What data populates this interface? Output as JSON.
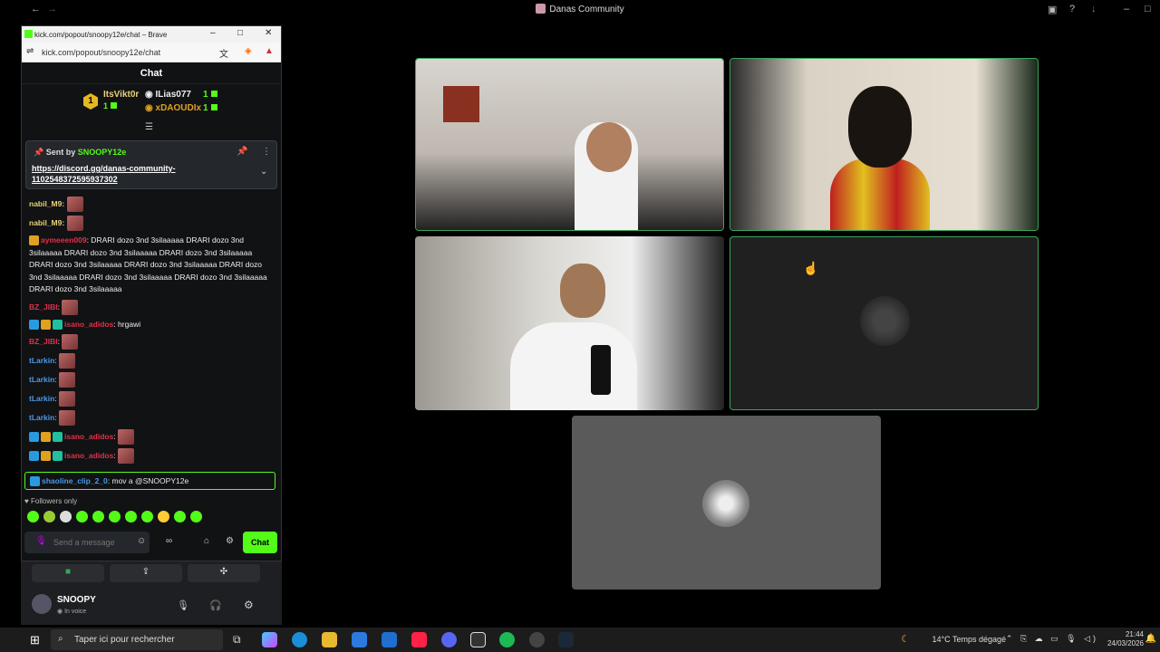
{
  "window": {
    "title": "Danas Community"
  },
  "chat_popout": {
    "tab_title": "kick.com/popout/snoopy12e/chat – Brave",
    "url": "kick.com/popout/snoopy12e/chat",
    "header": "Chat",
    "leaders": [
      {
        "rank": "1",
        "name": "ItsVikt0r",
        "count": "1"
      },
      {
        "name": "ILias077",
        "count": "1"
      },
      {
        "name": "xDAOUDIx",
        "count": "1"
      }
    ],
    "pinned": {
      "sent_by_label": "Sent by",
      "sender": "SNOOPY12e",
      "link": "https://discord.gg/danas-community-1102548372595937302"
    },
    "messages": [
      {
        "user": "nabil_M9:",
        "color": "#e8d27a",
        "text": ""
      },
      {
        "user": "nabil_M9:",
        "color": "#e8d27a",
        "text": ""
      },
      {
        "user": "aymeeen009",
        "color": "#e0a020",
        "text": ": DRARI dozo 3nd 3silaaaaa DRARI dozo 3nd 3silaaaaa DRARI dozo 3nd 3silaaaaa DRARI dozo 3nd 3silaaaaa DRARI dozo 3nd 3silaaaaa DRARI dozo 3nd 3silaaaaa DRARI dozo 3nd 3silaaaaa DRARI dozo 3nd 3silaaaaa DRARI dozo 3nd 3silaaaaa DRARI dozo 3nd 3silaaaaa"
      },
      {
        "user": "BZ_JIBI",
        "color": "#e0304a",
        "text": ":"
      },
      {
        "user": "isano_adidos",
        "color": "#e0304a",
        "text": ": hrgawi"
      },
      {
        "user": "BZ_JIBI",
        "color": "#e0304a",
        "text": ":"
      },
      {
        "user": "tLarkin",
        "color": "#4a9ae8",
        "text": ":"
      },
      {
        "user": "tLarkin",
        "color": "#4a9ae8",
        "text": ":"
      },
      {
        "user": "tLarkin",
        "color": "#4a9ae8",
        "text": ":"
      },
      {
        "user": "tLarkin",
        "color": "#4a9ae8",
        "text": ":"
      },
      {
        "user": "isano_adidos",
        "color": "#e0304a",
        "text": ":"
      },
      {
        "user": "isano_adidos",
        "color": "#e0304a",
        "text": ":"
      }
    ],
    "highlighted": {
      "user": "shaoline_clip_2_0",
      "text": ": mov a @SNOOPY12e"
    },
    "followers_only": "Followers only",
    "input_placeholder": "Send a message",
    "chat_button": "Chat"
  },
  "voice_panel": {
    "username": "SNOOPY",
    "status": "In voice"
  },
  "taskbar": {
    "search_placeholder": "Taper ici pour rechercher",
    "weather": "14°C",
    "weather_desc": "Temps dégagé",
    "time": "21:44",
    "date": "24/03/2026"
  },
  "colors": {
    "kick_green": "#53fc18",
    "speaking": "#3ba55d"
  }
}
